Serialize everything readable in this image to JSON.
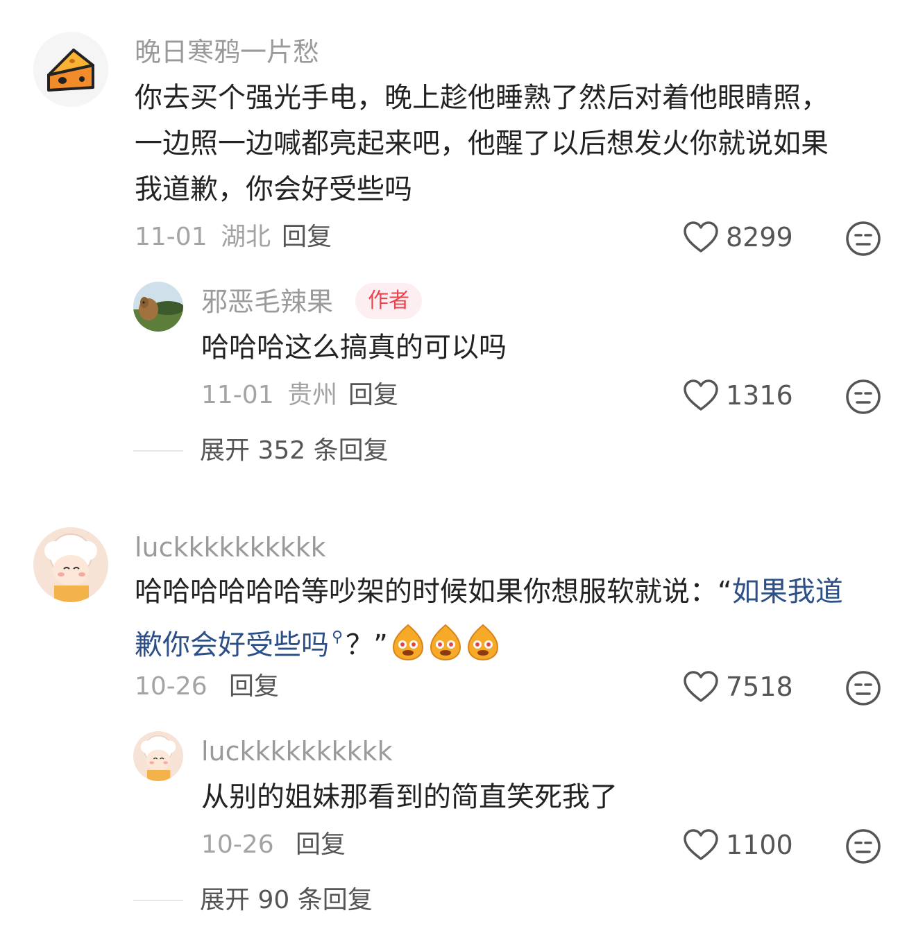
{
  "comments": [
    {
      "username": "晚日寒鸦一片愁",
      "avatar_icon": "cheese-icon",
      "text_lines": [
        "你去买个强光手电，晚上趁他睡熟了然后对着他眼睛照，",
        "一边照一边喊都亮起来吧，他醒了以后想发火你就说如果",
        "我道歉，你会好受些吗"
      ],
      "date": "11-01",
      "location": "湖北",
      "reply_label": "回复",
      "likes": "8299",
      "replies": [
        {
          "username": "邪恶毛辣果",
          "badge": "作者",
          "avatar_icon": "camel-landscape-avatar",
          "text": "哈哈哈这么搞真的可以吗",
          "date": "11-01",
          "location": "贵州",
          "reply_label": "回复",
          "likes": "1316"
        }
      ],
      "expand_label": "展开 352 条回复"
    },
    {
      "username": "luckkkkkkkkkk",
      "avatar_icon": "sheep-cartoon-avatar",
      "text_line1_plain": "哈哈哈哈哈哈等吵架的时候如果你想服软就说：“",
      "text_line1_link": "如果我道",
      "text_line2_link": "歉你会好受些吗",
      "text_line2_tail": "？”",
      "emoji_icon": "teary-face-emoji",
      "date": "10-26",
      "reply_label": "回复",
      "likes": "7518",
      "replies": [
        {
          "username": "luckkkkkkkkkk",
          "avatar_icon": "sheep-cartoon-avatar",
          "text": "从别的姐妹那看到的简直笑死我了",
          "date": "10-26",
          "reply_label": "回复",
          "likes": "1100"
        }
      ],
      "expand_label": "展开 90 条回复"
    }
  ],
  "colors": {
    "username": "#9a9a9a",
    "author_badge_bg": "#fdeff1",
    "author_badge_text": "#e8454f",
    "link": "#2b4f86"
  }
}
